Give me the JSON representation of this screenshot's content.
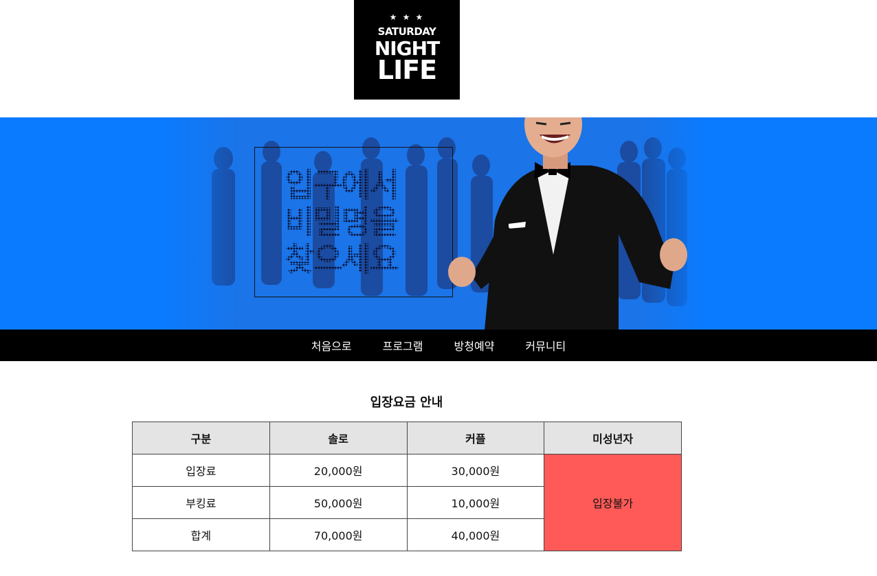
{
  "logo": {
    "stars": "★ ★ ★",
    "line1": "SATURDAY",
    "line2": "NIGHT",
    "line3": "LIFE"
  },
  "banner": {
    "headline": [
      "입구에서",
      "비밀명을",
      "찾으세요"
    ],
    "accent_color": "#0a7bff"
  },
  "nav": {
    "items": [
      "처음으로",
      "프로그램",
      "방청예약",
      "커뮤니티"
    ]
  },
  "section": {
    "title": "입장요금 안내"
  },
  "fees_table": {
    "headers": [
      "구분",
      "솔로",
      "커플",
      "미성년자"
    ],
    "rows": [
      {
        "label": "입장료",
        "solo": "20,000원",
        "couple": "30,000원"
      },
      {
        "label": "부킹료",
        "solo": "50,000원",
        "couple": "10,000원"
      },
      {
        "label": "합계",
        "solo": "70,000원",
        "couple": "40,000원"
      }
    ],
    "minor_value": "입장불가",
    "minor_color": "#ff5a57"
  }
}
